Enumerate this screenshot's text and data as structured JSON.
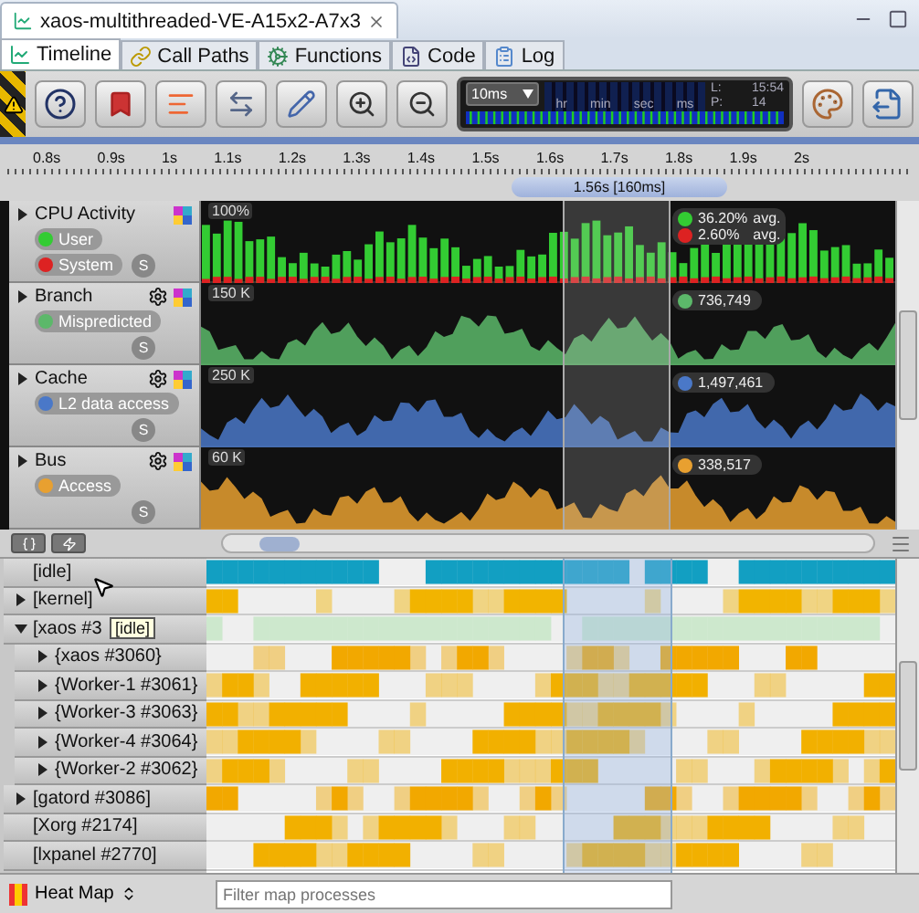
{
  "document_tab": {
    "title": "xaos-multithreaded-VE-A15x2-A7x3"
  },
  "tabs": [
    {
      "label": "Timeline",
      "kind": "timeline",
      "selected": true
    },
    {
      "label": "Call Paths",
      "kind": "paths",
      "selected": false
    },
    {
      "label": "Functions",
      "kind": "functions",
      "selected": false
    },
    {
      "label": "Code",
      "kind": "code",
      "selected": false
    },
    {
      "label": "Log",
      "kind": "log",
      "selected": false
    }
  ],
  "toolbar": {
    "interval": "10ms",
    "clock_units": [
      "hr",
      "min",
      "sec",
      "ms"
    ],
    "l_label": "L:",
    "l_value": "15:54",
    "p_label": "P:",
    "p_value": "14"
  },
  "ruler": {
    "ticks": [
      "0.8s",
      "0.9s",
      "1s",
      "1.1s",
      "1.2s",
      "1.3s",
      "1.4s",
      "1.5s",
      "1.6s",
      "1.7s",
      "1.8s",
      "1.9s",
      "2s"
    ],
    "selection": "1.56s [160ms]"
  },
  "series": [
    {
      "name": "CPU Activity",
      "kind": "bars",
      "settings": false,
      "solo": "S",
      "scale": "100%",
      "legend": [
        {
          "label": "User",
          "color": "#33cc33"
        },
        {
          "label": "System",
          "color": "#dd2222"
        }
      ],
      "readouts": [
        {
          "value": "36.20%",
          "suffix": "avg.",
          "color": "#33cc33"
        },
        {
          "value": "2.60%",
          "suffix": "avg.",
          "color": "#dd2222"
        }
      ]
    },
    {
      "name": "Branch",
      "kind": "area",
      "settings": true,
      "solo": "S",
      "scale": "150 K",
      "legend": [
        {
          "label": "Mispredicted",
          "color": "#5cb86a"
        }
      ],
      "readouts": [
        {
          "value": "736,749",
          "color": "#5cb86a"
        }
      ]
    },
    {
      "name": "Cache",
      "kind": "area",
      "settings": true,
      "solo": "S",
      "scale": "250 K",
      "legend": [
        {
          "label": "L2 data access",
          "color": "#4a78c8"
        }
      ],
      "readouts": [
        {
          "value": "1,497,461",
          "color": "#4a78c8"
        }
      ]
    },
    {
      "name": "Bus",
      "kind": "area",
      "settings": true,
      "solo": "S",
      "scale": "60 K",
      "legend": [
        {
          "label": "Access",
          "color": "#e8a030"
        }
      ],
      "readouts": [
        {
          "value": "338,517",
          "color": "#e8a030"
        }
      ]
    }
  ],
  "processes": [
    {
      "name": "[idle]",
      "expandable": false,
      "expanded": false,
      "color": "#129fc2"
    },
    {
      "name": "[kernel]",
      "expandable": true,
      "expanded": false,
      "color": "#f2b400"
    },
    {
      "name": "[xaos #3",
      "expandable": true,
      "expanded": true,
      "color": "#cde8cd",
      "children": [
        {
          "name": "{xaos #3060}",
          "expandable": true,
          "expanded": false,
          "color": "#f2a800"
        },
        {
          "name": "{Worker-1 #3061}",
          "expandable": true,
          "expanded": false,
          "color": "#f2b000"
        },
        {
          "name": "{Worker-3 #3063}",
          "expandable": true,
          "expanded": false,
          "color": "#f2b000"
        },
        {
          "name": "{Worker-4 #3064}",
          "expandable": true,
          "expanded": false,
          "color": "#f2b000"
        },
        {
          "name": "{Worker-2 #3062}",
          "expandable": true,
          "expanded": false,
          "color": "#f2b000"
        }
      ]
    },
    {
      "name": "[gatord #3086]",
      "expandable": true,
      "expanded": false,
      "color": "#f2a800"
    },
    {
      "name": "[Xorg #2174]",
      "expandable": false,
      "expanded": false,
      "color": "#f2b000"
    },
    {
      "name": "[lxpanel #2770]",
      "expandable": false,
      "expanded": false,
      "color": "#f2b000"
    }
  ],
  "tooltip": "[idle]",
  "footer": {
    "mode": "Heat Map",
    "filter_placeholder": "Filter map processes"
  }
}
